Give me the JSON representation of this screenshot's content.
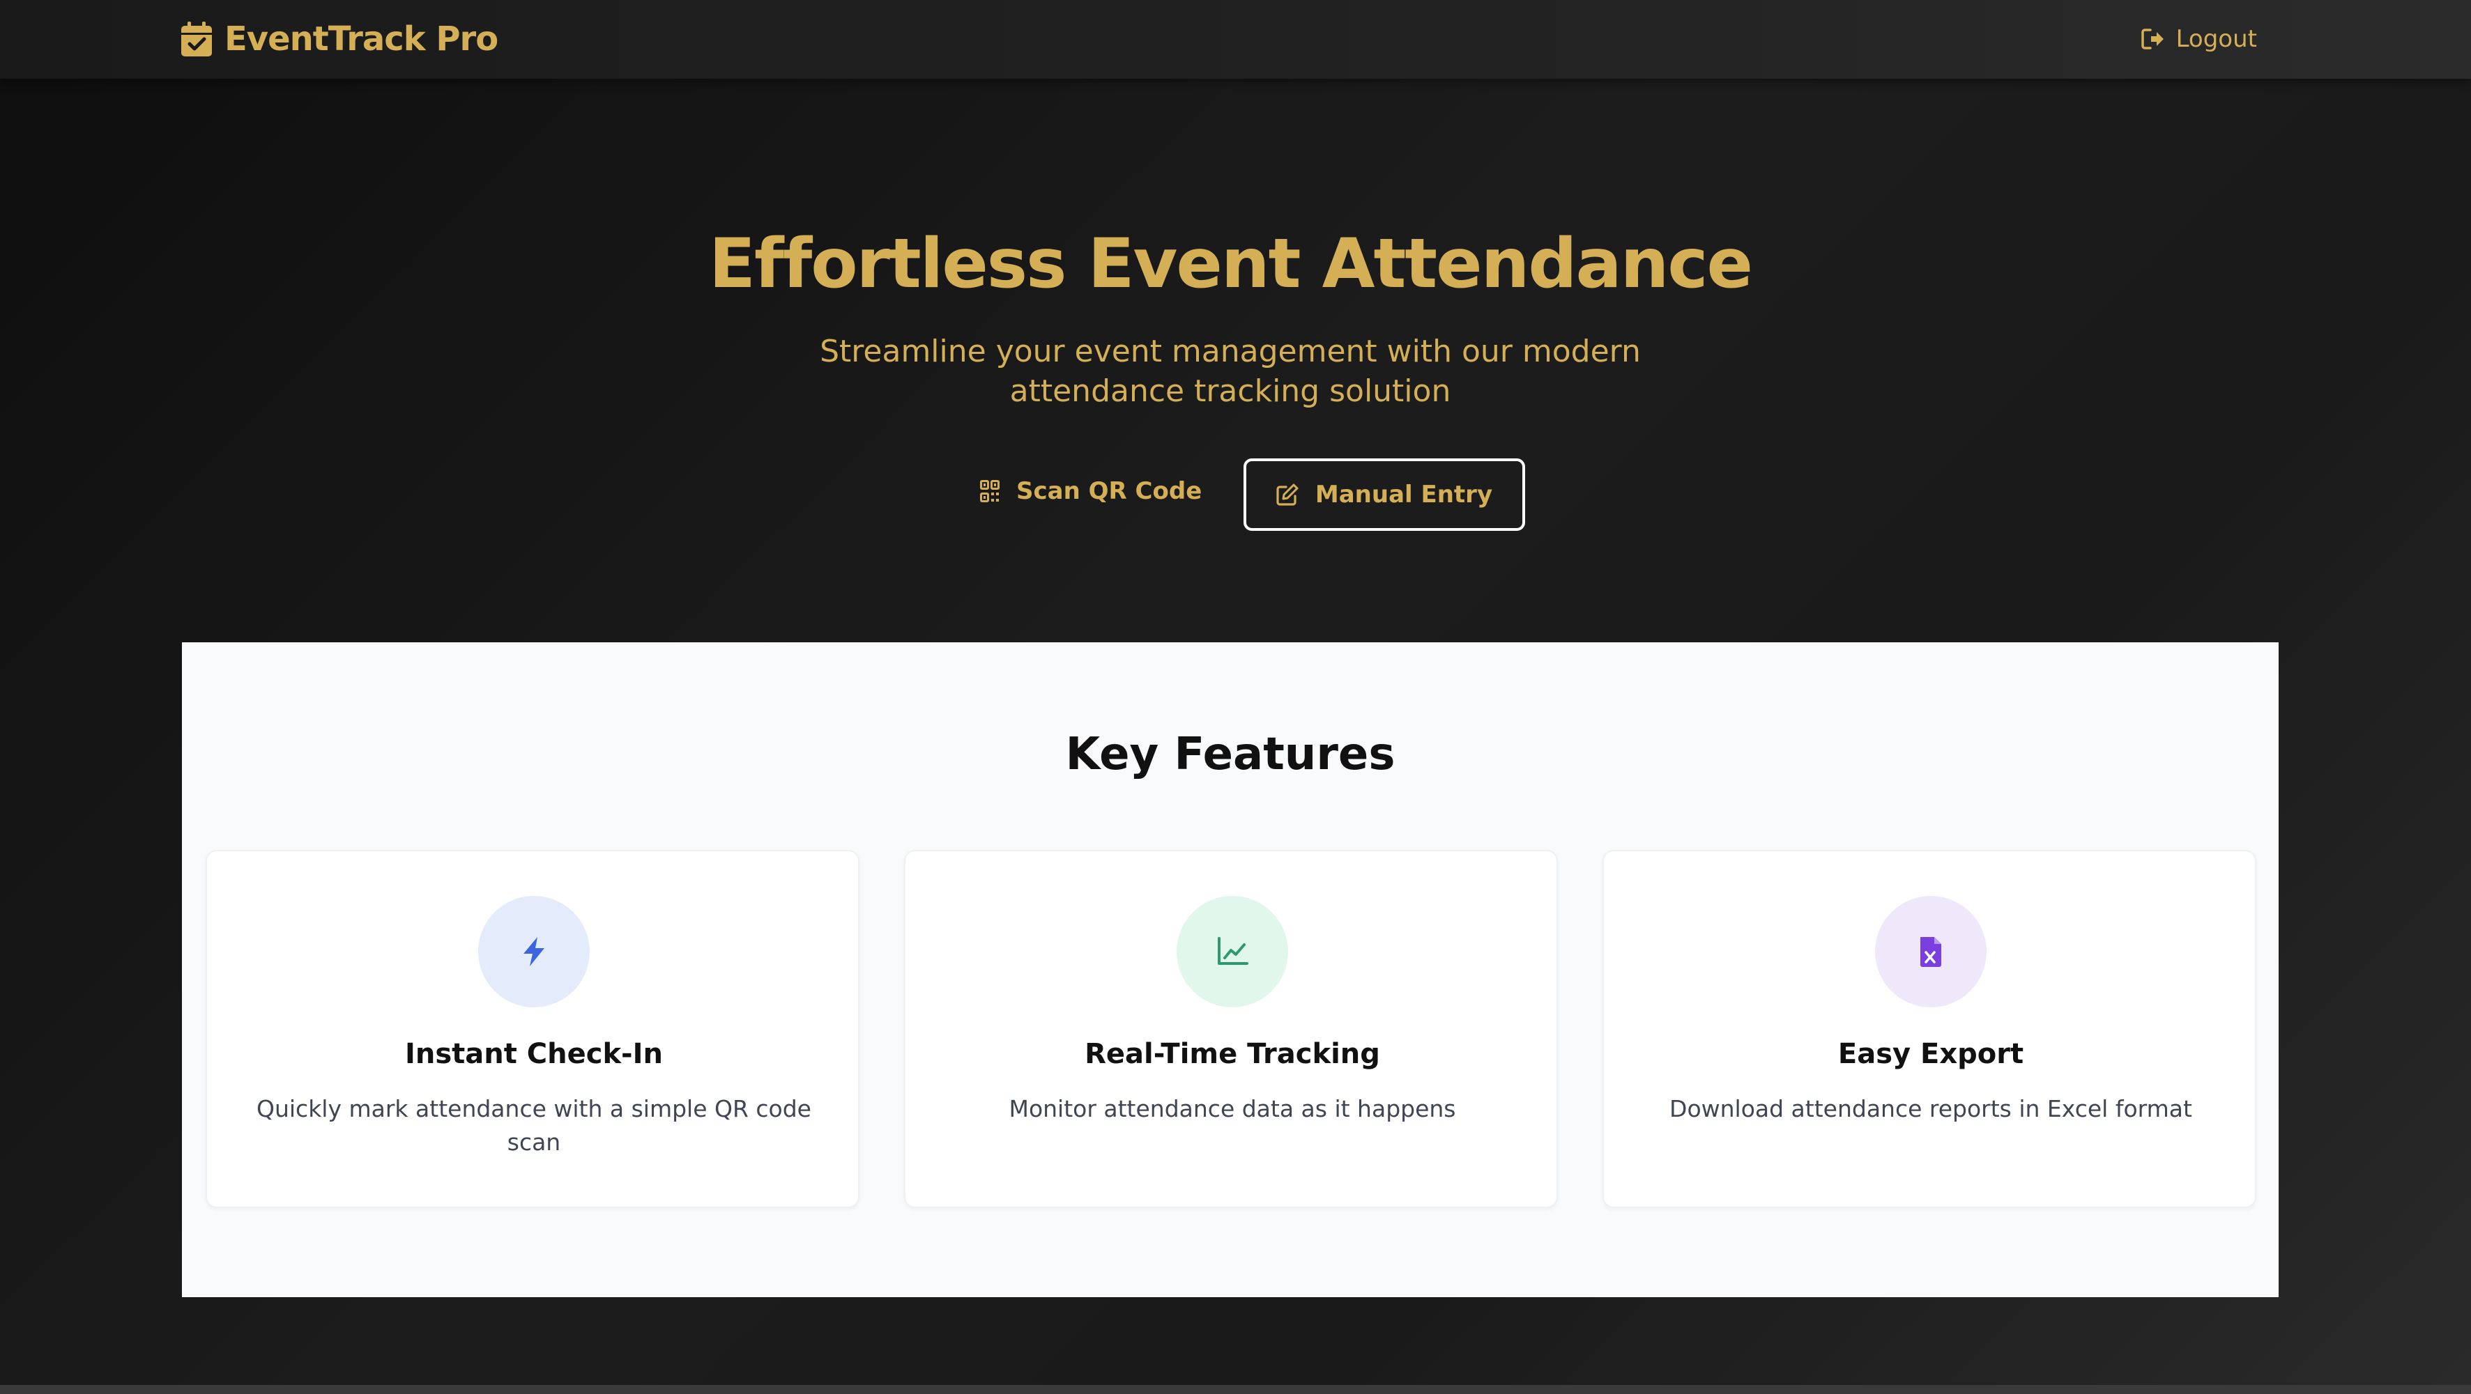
{
  "navbar": {
    "brand": "EventTrack Pro",
    "brand_icon": "calendar-check-icon",
    "logout_label": "Logout",
    "logout_icon": "sign-out-icon"
  },
  "hero": {
    "title": "Effortless Event Attendance",
    "subtitle": "Streamline your event management with our modern attendance tracking solution",
    "scan_button": {
      "label": "Scan QR Code",
      "icon": "qrcode-icon"
    },
    "manual_button": {
      "label": "Manual Entry",
      "icon": "edit-icon"
    }
  },
  "features": {
    "title": "Key Features",
    "items": [
      {
        "title": "Instant Check-In",
        "description": "Quickly mark attendance with a simple QR code scan",
        "icon": "bolt-icon",
        "icon_color": "#3b66e0",
        "icon_bg": "#e4ecfb"
      },
      {
        "title": "Real-Time Tracking",
        "description": "Monitor attendance data as it happens",
        "icon": "chart-line-icon",
        "icon_color": "#2f9a6e",
        "icon_bg": "#e2f7ec"
      },
      {
        "title": "Easy Export",
        "description": "Download attendance reports in Excel format",
        "icon": "file-excel-icon",
        "icon_color": "#7b3fe0",
        "icon_bg": "#efe8fb"
      }
    ]
  },
  "colors": {
    "accent_gold": "#d4af55",
    "dark_bg": "#141414",
    "section_bg": "#f8fafc"
  }
}
